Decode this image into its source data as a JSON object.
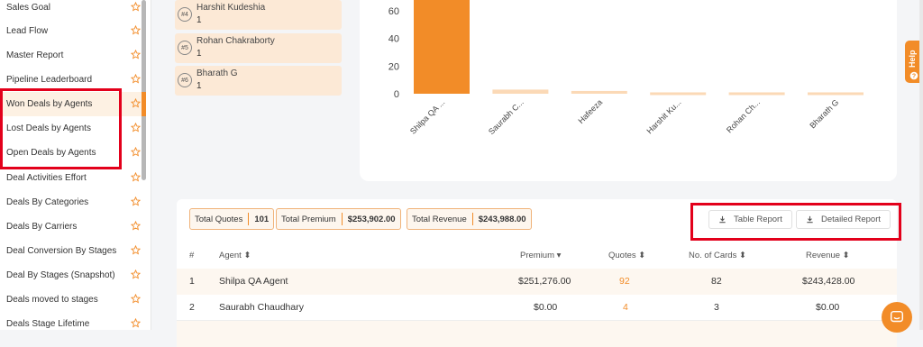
{
  "sidebar": {
    "items": [
      {
        "label": "Sales Goal"
      },
      {
        "label": "Lead Flow"
      },
      {
        "label": "Master Report"
      },
      {
        "label": "Pipeline Leaderboard"
      },
      {
        "label": "Won Deals by Agents"
      },
      {
        "label": "Lost Deals by Agents"
      },
      {
        "label": "Open Deals by Agents"
      },
      {
        "label": "Deal Activities Effort"
      },
      {
        "label": "Deals By Categories"
      },
      {
        "label": "Deals By Carriers"
      },
      {
        "label": "Deal Conversion By Stages"
      },
      {
        "label": "Deal By Stages (Snapshot)"
      },
      {
        "label": "Deals moved to stages"
      },
      {
        "label": "Deals Stage Lifetime"
      }
    ]
  },
  "leaderboard": [
    {
      "rank": "#4",
      "name": "Harshit Kudeshia",
      "value": "1"
    },
    {
      "rank": "#5",
      "name": "Rohan Chakraborty",
      "value": "1"
    },
    {
      "rank": "#6",
      "name": "Bharath G",
      "value": "1"
    }
  ],
  "chart_data": {
    "type": "bar",
    "categories": [
      "Shilpa QA ...",
      "Saurabh C...",
      "Hafeeza",
      "Harshit Ku...",
      "Rohan Ch...",
      "Bharath G"
    ],
    "values": [
      82,
      3,
      2,
      1,
      1,
      1
    ],
    "y_ticks": [
      "0",
      "20",
      "40",
      "60"
    ],
    "ylim": [
      0,
      70
    ],
    "colors": [
      "#f28c28",
      "#fbd9b6",
      "#fbd9b6",
      "#fbd9b6",
      "#fbd9b6",
      "#fbd9b6"
    ]
  },
  "stats": {
    "total_quotes_label": "Total Quotes",
    "total_quotes_value": "101",
    "total_premium_label": "Total Premium",
    "total_premium_value": "$253,902.00",
    "total_revenue_label": "Total Revenue",
    "total_revenue_value": "$243,988.00"
  },
  "buttons": {
    "table_report": "Table Report",
    "detailed_report": "Detailed Report"
  },
  "table": {
    "headers": {
      "num": "#",
      "agent": "Agent ⬍",
      "premium": "Premium ▾",
      "quotes": "Quotes ⬍",
      "cards": "No. of Cards ⬍",
      "revenue": "Revenue ⬍"
    },
    "rows": [
      {
        "num": "1",
        "agent": "Shilpa QA Agent",
        "premium": "$251,276.00",
        "quotes": "92",
        "cards": "82",
        "revenue": "$243,428.00"
      },
      {
        "num": "2",
        "agent": "Saurabh Chaudhary",
        "premium": "$0.00",
        "quotes": "4",
        "cards": "3",
        "revenue": "$0.00"
      }
    ]
  },
  "help_label": "Help",
  "colors": {
    "accent": "#f28c28",
    "highlight": "#e3001b"
  }
}
